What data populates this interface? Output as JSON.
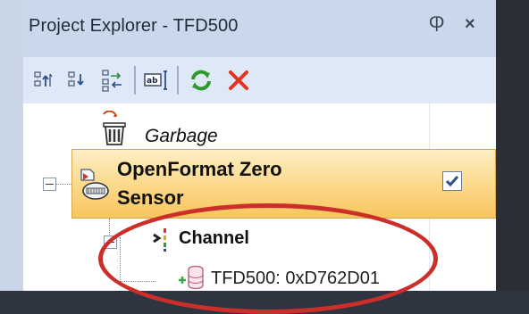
{
  "window": {
    "title": "Project Explorer - TFD500",
    "pin_glyph": "Ⴔ",
    "close_glyph": "×"
  },
  "toolbar": {
    "buttons": [
      {
        "icon": "move-up-icon"
      },
      {
        "icon": "move-down-icon"
      },
      {
        "icon": "reorder-icon"
      },
      {
        "icon": "rename-icon"
      },
      {
        "icon": "refresh-icon"
      },
      {
        "icon": "delete-icon"
      }
    ]
  },
  "tree": {
    "garbage": {
      "label": "Garbage",
      "icon": "trash-bin-icon"
    },
    "sensor": {
      "label_line1": "OpenFormat Zero",
      "label_line2": "Sensor",
      "checked": true,
      "icon": "sensor-icon"
    },
    "channel": {
      "label": "Channel",
      "icon": "channel-icon"
    },
    "device": {
      "label": "TFD500: 0xD762D01",
      "icon": "database-icon"
    }
  },
  "colors": {
    "highlight": "#f7c65e",
    "annotation": "#cc2f2a",
    "refresh": "#2e9a2e",
    "delete": "#e2331f"
  }
}
